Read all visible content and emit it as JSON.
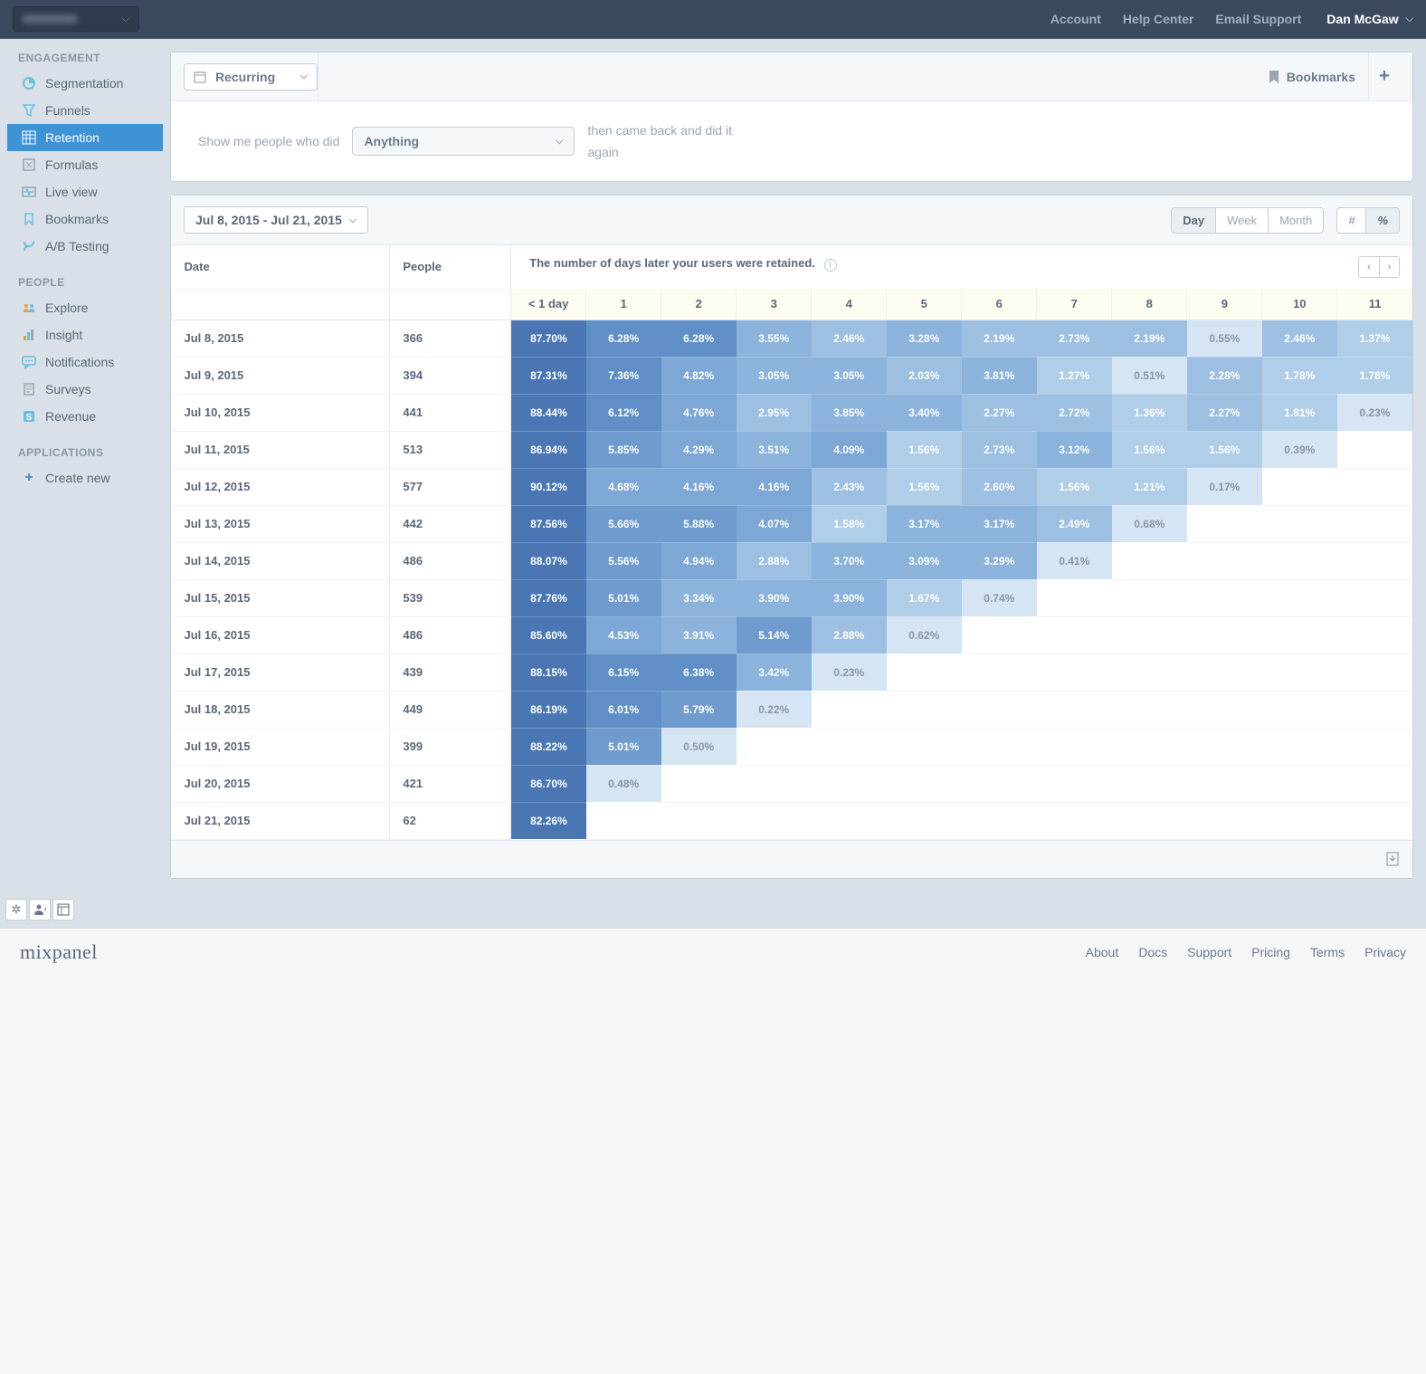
{
  "topbar": {
    "links": [
      "Account",
      "Help Center",
      "Email Support"
    ],
    "user": "Dan McGaw"
  },
  "sidebar": {
    "engagement": {
      "title": "ENGAGEMENT",
      "items": [
        "Segmentation",
        "Funnels",
        "Retention",
        "Formulas",
        "Live view",
        "Bookmarks",
        "A/B Testing"
      ]
    },
    "people": {
      "title": "PEOPLE",
      "items": [
        "Explore",
        "Insight",
        "Notifications",
        "Surveys",
        "Revenue"
      ]
    },
    "applications": {
      "title": "APPLICATIONS",
      "create": "Create new"
    }
  },
  "query": {
    "recurring": "Recurring",
    "bookmarks": "Bookmarks",
    "prompt1": "Show me people who did",
    "event": "Anything",
    "prompt2a": "then came back and did it",
    "prompt2b": "again"
  },
  "toolbar": {
    "date_range": "Jul 8, 2015 - Jul 21, 2015",
    "granularity": [
      "Day",
      "Week",
      "Month"
    ],
    "format": [
      "#",
      "%"
    ]
  },
  "table": {
    "date_header": "Date",
    "people_header": "People",
    "desc": "The number of days later your users were retained.",
    "buckets": [
      "< 1 day",
      "1",
      "2",
      "3",
      "4",
      "5",
      "6",
      "7",
      "8",
      "9",
      "10",
      "11"
    ],
    "rows": [
      {
        "date": "Jul 8, 2015",
        "people": 366,
        "cells": [
          "87.70%",
          "6.28%",
          "6.28%",
          "3.55%",
          "2.46%",
          "3.28%",
          "2.19%",
          "2.73%",
          "2.19%",
          "0.55%",
          "2.46%",
          "1.37%"
        ]
      },
      {
        "date": "Jul 9, 2015",
        "people": 394,
        "cells": [
          "87.31%",
          "7.36%",
          "4.82%",
          "3.05%",
          "3.05%",
          "2.03%",
          "3.81%",
          "1.27%",
          "0.51%",
          "2.28%",
          "1.78%",
          "1.78%"
        ]
      },
      {
        "date": "Jul 10, 2015",
        "people": 441,
        "cells": [
          "88.44%",
          "6.12%",
          "4.76%",
          "2.95%",
          "3.85%",
          "3.40%",
          "2.27%",
          "2.72%",
          "1.36%",
          "2.27%",
          "1.81%",
          "0.23%"
        ]
      },
      {
        "date": "Jul 11, 2015",
        "people": 513,
        "cells": [
          "86.94%",
          "5.85%",
          "4.29%",
          "3.51%",
          "4.09%",
          "1.56%",
          "2.73%",
          "3.12%",
          "1.56%",
          "1.56%",
          "0.39%"
        ]
      },
      {
        "date": "Jul 12, 2015",
        "people": 577,
        "cells": [
          "90.12%",
          "4.68%",
          "4.16%",
          "4.16%",
          "2.43%",
          "1.56%",
          "2.60%",
          "1.56%",
          "1.21%",
          "0.17%"
        ]
      },
      {
        "date": "Jul 13, 2015",
        "people": 442,
        "cells": [
          "87.56%",
          "5.66%",
          "5.88%",
          "4.07%",
          "1.58%",
          "3.17%",
          "3.17%",
          "2.49%",
          "0.68%"
        ]
      },
      {
        "date": "Jul 14, 2015",
        "people": 486,
        "cells": [
          "88.07%",
          "5.56%",
          "4.94%",
          "2.88%",
          "3.70%",
          "3.09%",
          "3.29%",
          "0.41%"
        ]
      },
      {
        "date": "Jul 15, 2015",
        "people": 539,
        "cells": [
          "87.76%",
          "5.01%",
          "3.34%",
          "3.90%",
          "3.90%",
          "1.67%",
          "0.74%"
        ]
      },
      {
        "date": "Jul 16, 2015",
        "people": 486,
        "cells": [
          "85.60%",
          "4.53%",
          "3.91%",
          "5.14%",
          "2.88%",
          "0.62%"
        ]
      },
      {
        "date": "Jul 17, 2015",
        "people": 439,
        "cells": [
          "88.15%",
          "6.15%",
          "6.38%",
          "3.42%",
          "0.23%"
        ]
      },
      {
        "date": "Jul 18, 2015",
        "people": 449,
        "cells": [
          "86.19%",
          "6.01%",
          "5.79%",
          "0.22%"
        ]
      },
      {
        "date": "Jul 19, 2015",
        "people": 399,
        "cells": [
          "88.22%",
          "5.01%",
          "0.50%"
        ]
      },
      {
        "date": "Jul 20, 2015",
        "people": 421,
        "cells": [
          "86.70%",
          "0.48%"
        ]
      },
      {
        "date": "Jul 21, 2015",
        "people": 62,
        "cells": [
          "82.26%"
        ]
      }
    ]
  },
  "footer": {
    "logo": "mixpanel",
    "links": [
      "About",
      "Docs",
      "Support",
      "Pricing",
      "Terms",
      "Privacy"
    ]
  }
}
